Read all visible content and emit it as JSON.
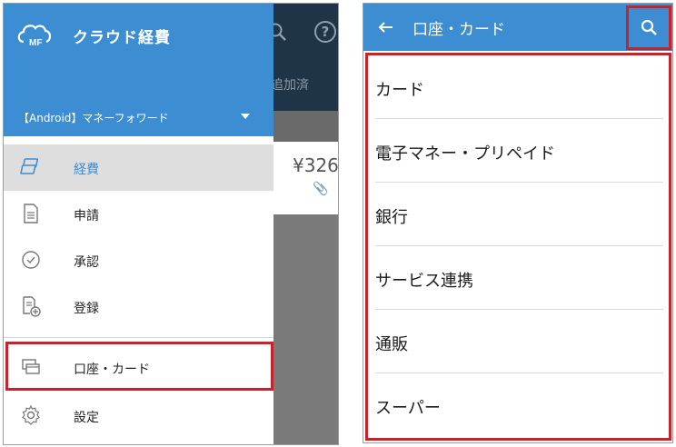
{
  "left": {
    "app_title": "クラウド経費",
    "logo_mark": "MF",
    "account_name": "【Android】マネーフォワード",
    "menu": [
      {
        "label": "経費",
        "icon": "cards-icon",
        "active": true
      },
      {
        "label": "申請",
        "icon": "document-icon",
        "active": false
      },
      {
        "label": "承認",
        "icon": "check-circle-icon",
        "active": false
      },
      {
        "label": "登録",
        "icon": "document-add-icon",
        "active": false
      },
      {
        "label": "口座・カード",
        "icon": "wallet-card-icon",
        "active": false
      },
      {
        "label": "設定",
        "icon": "gear-icon",
        "active": false
      }
    ],
    "behind": {
      "tab_text": "追加済",
      "amount": "¥326",
      "help_glyph": "?"
    }
  },
  "right": {
    "title": "口座・カード",
    "items": [
      {
        "label": "カード"
      },
      {
        "label": "電子マネー・プリペイド"
      },
      {
        "label": "銀行"
      },
      {
        "label": "サービス連携"
      },
      {
        "label": "通販"
      },
      {
        "label": "スーパー"
      }
    ]
  },
  "colors": {
    "header_blue": "#3c8dd2",
    "highlight_red": "#c8232c",
    "active_bg": "#dedede"
  }
}
